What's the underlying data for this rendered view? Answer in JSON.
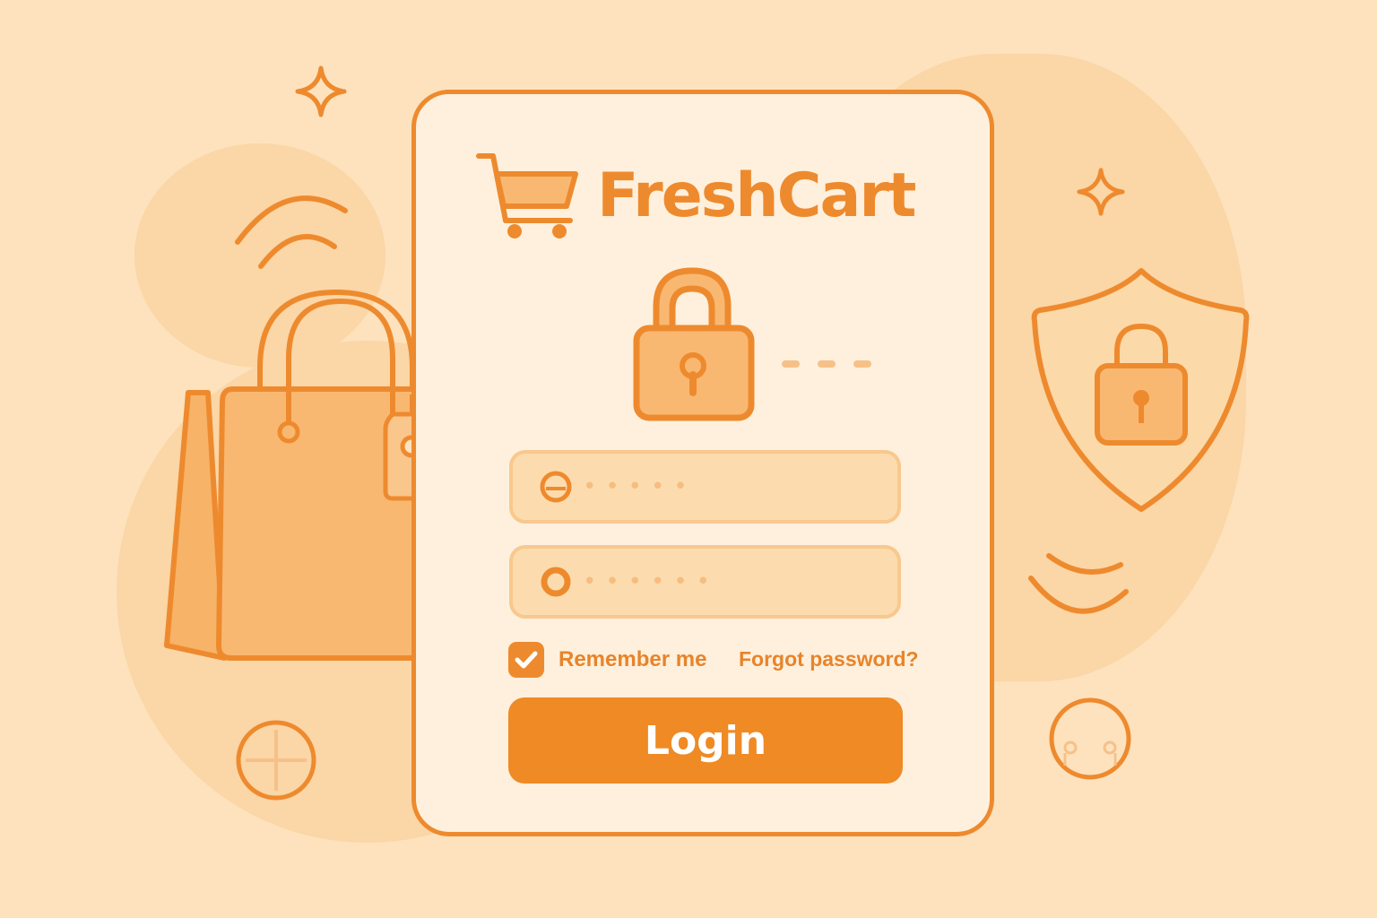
{
  "brand": {
    "name": "FreshCart",
    "logo_icon": "shopping-cart-icon"
  },
  "form": {
    "username": {
      "placeholder": "•••••",
      "icon": "user-icon"
    },
    "password": {
      "placeholder": "••••••",
      "icon": "key-icon"
    },
    "remember_me": {
      "label": "Remember me",
      "checked": true
    },
    "forgot_password": "Forgot password?",
    "login_button": "Login"
  },
  "colors": {
    "background": "#fde2bd",
    "card": "#fef0dd",
    "accent": "#ee8a2e",
    "field": "#fcdcae"
  },
  "decorations": [
    "shopping-bag-icon",
    "price-tag-icon",
    "padlock-icon",
    "shield-lock-icon",
    "sparkle-icon",
    "wifi-arc-icon",
    "plus-circle-icon",
    "smiley-circle-icon"
  ]
}
